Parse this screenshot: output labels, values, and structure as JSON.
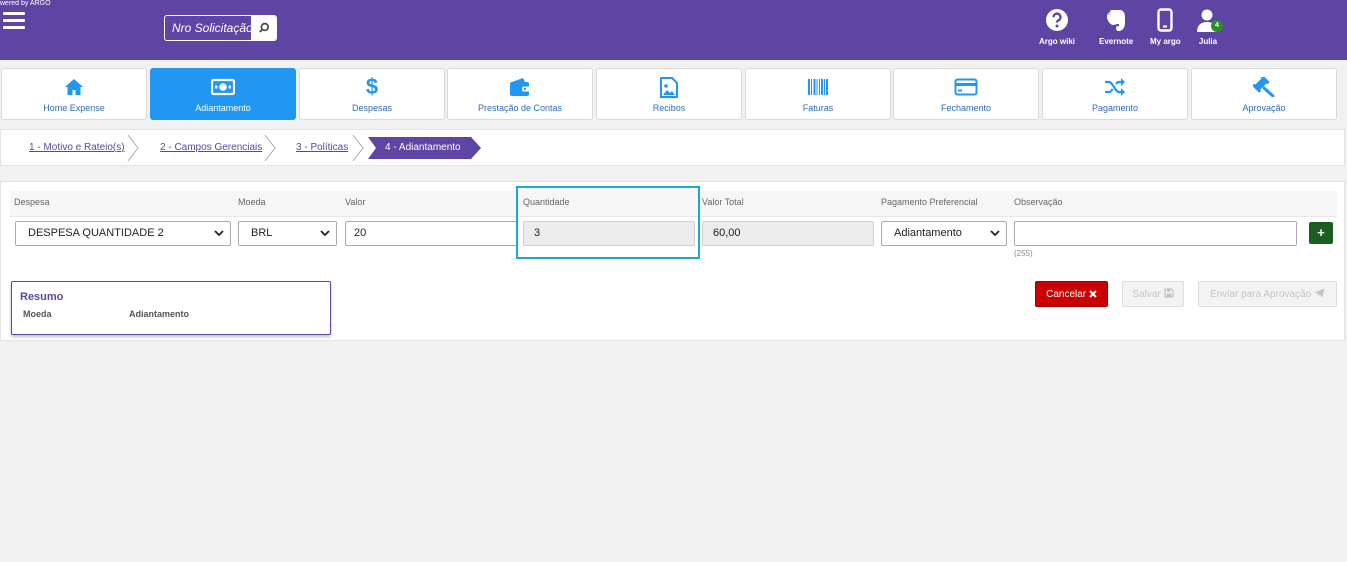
{
  "header": {
    "powered": "wered by ARGO",
    "search_placeholder": "Nro Solicitação",
    "icons": [
      {
        "name": "question-icon",
        "label": "Argo wiki"
      },
      {
        "name": "evernote-icon",
        "label": "Evernote"
      },
      {
        "name": "mobile-icon",
        "label": "My argo"
      },
      {
        "name": "user-icon",
        "label": "Julia",
        "badge": "4"
      }
    ]
  },
  "tabs": [
    {
      "label": "Home Expense",
      "icon": "home-icon"
    },
    {
      "label": "Adiantamento",
      "icon": "money-icon",
      "active": true
    },
    {
      "label": "Despesas",
      "icon": "dollar-icon"
    },
    {
      "label": "Prestação de Contas",
      "icon": "wallet-icon"
    },
    {
      "label": "Recibos",
      "icon": "image-icon"
    },
    {
      "label": "Faturas",
      "icon": "barcode-icon"
    },
    {
      "label": "Fechamento",
      "icon": "credit-card-icon"
    },
    {
      "label": "Pagamento",
      "icon": "shuffle-icon"
    },
    {
      "label": "Aprovação",
      "icon": "gavel-icon"
    }
  ],
  "steps": [
    "1 - Motivo e Rateio(s)",
    "2 - Campos Gerenciais",
    "3 - Políticas",
    "4 - Adiantamento"
  ],
  "form": {
    "headers": {
      "despesa": "Despesa",
      "moeda": "Moeda",
      "valor": "Valor",
      "quantidade": "Quantidade",
      "valor_total": "Valor Total",
      "pagamento": "Pagamento Preferencial",
      "observacao": "Observação"
    },
    "values": {
      "despesa": "DESPESA QUANTIDADE 2",
      "moeda": "BRL",
      "valor": "20",
      "quantidade": "3",
      "valor_total": "60,00",
      "pagamento": "Adiantamento",
      "observacao": ""
    },
    "observacao_counter": "(255)",
    "add_label": "+"
  },
  "resumo": {
    "title": "Resumo",
    "col_moeda": "Moeda",
    "col_adiantamento": "Adiantamento"
  },
  "actions": {
    "cancel": "Cancelar",
    "save": "Salvar",
    "send": "Enviar para Aprovação"
  },
  "colors": {
    "brand": "#5f45a3",
    "active_tab": "#2196f3",
    "highlight": "#1aa8d2",
    "cancel": "#cc0000",
    "add": "#1a5e20"
  }
}
